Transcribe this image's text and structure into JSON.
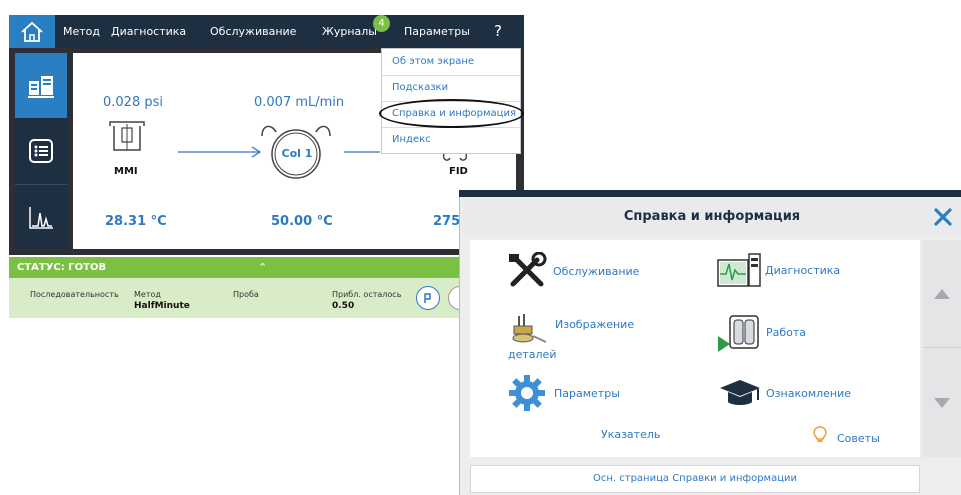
{
  "nav": {
    "method": "Метод",
    "diagnostics": "Диагностика",
    "maintenance": "Обслуживание",
    "journals": "Журналы",
    "journals_badge": "4",
    "settings": "Параметры",
    "help": "?"
  },
  "flow": {
    "inlet_pressure": "0.028 psi",
    "column_flow": "0.007 mL/min",
    "inlet_name": "MMI",
    "column_name": "Col 1",
    "detector_name": "FID",
    "inlet_temp": "28.31 °C",
    "column_temp": "50.00 °C",
    "detector_temp": "275."
  },
  "status": {
    "text": "СТАТУС: ГОТОВ",
    "sequence_label": "Последовательность",
    "method_label": "Метод",
    "method_value": "HalfMinute",
    "sample_label": "Проба",
    "remaining_label": "Прибл. осталось",
    "remaining_value": "0.50"
  },
  "dropdown": {
    "items": [
      "Об этом экране",
      "Подсказки",
      "Справка и информация",
      "Индекс"
    ]
  },
  "dialog": {
    "title": "Справка и информация",
    "items": {
      "maintenance": "Обслуживание",
      "diagnostics": "Диагностика",
      "parts_image_1": "Изображение",
      "parts_image_2": "деталей",
      "operation": "Работа",
      "settings": "Параметры",
      "intro": "Ознакомление",
      "index": "Указатель",
      "tips": "Советы"
    },
    "footer": "Осн. страница Справки и информации"
  },
  "colors": {
    "navy": "#1e2f42",
    "accent_blue": "#2a7fc2",
    "status_green": "#7ac143",
    "link_blue": "#2f78c4"
  }
}
